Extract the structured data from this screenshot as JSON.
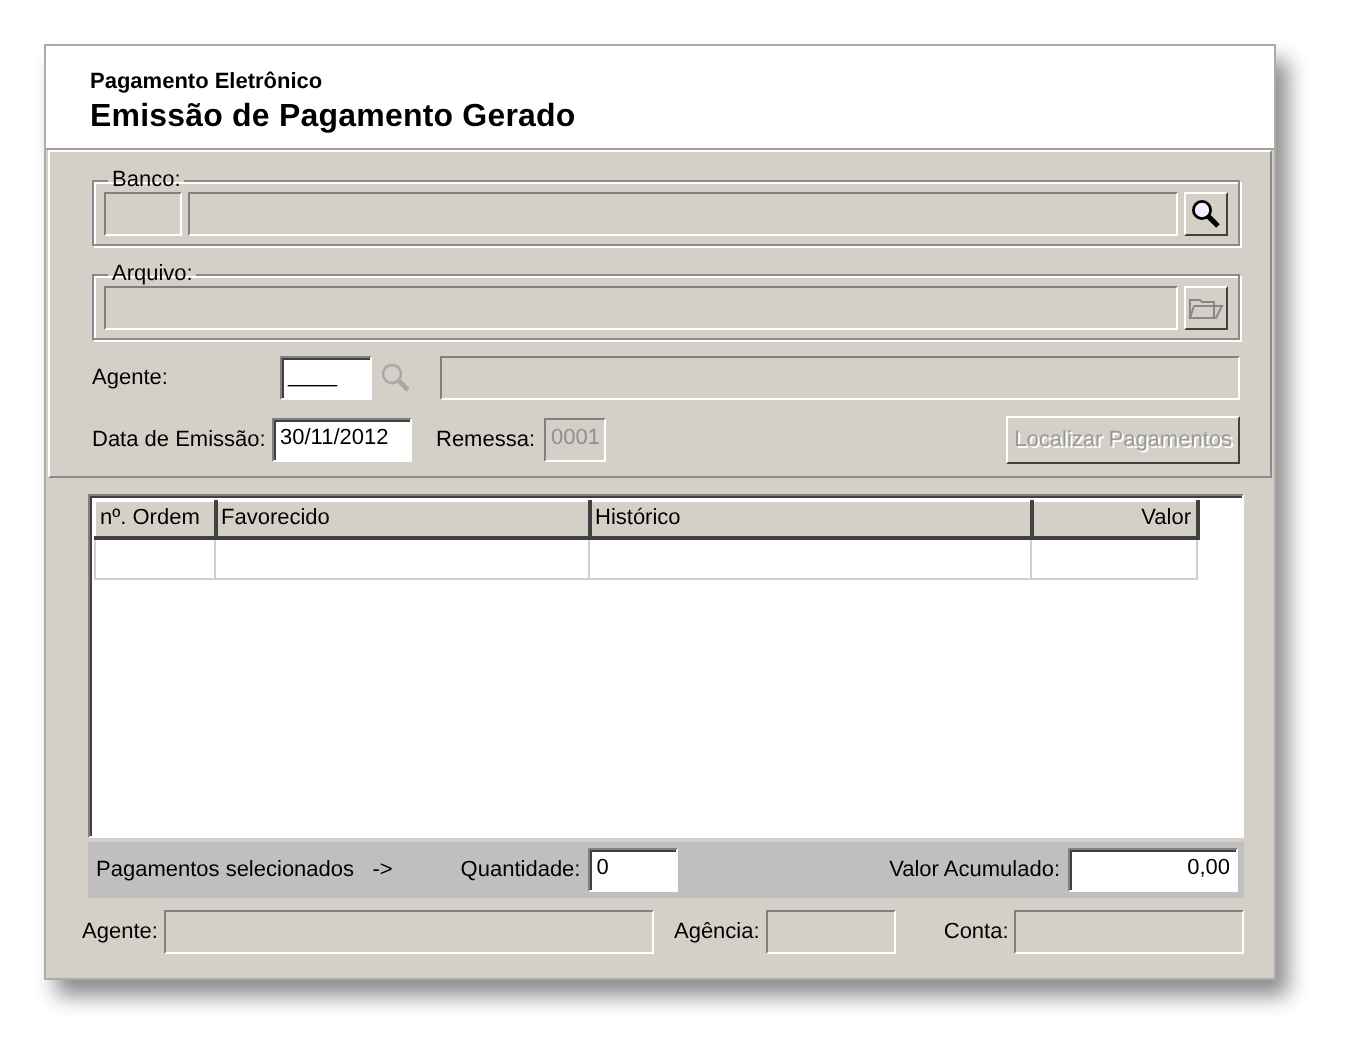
{
  "header": {
    "subtitle": "Pagamento Eletrônico",
    "title": "Emissão de Pagamento Gerado"
  },
  "banco": {
    "legend": "Banco:",
    "code": {
      "disabled": true
    },
    "name": {
      "disabled": true
    }
  },
  "arquivo": {
    "legend": "Arquivo:",
    "path": {
      "disabled": true
    }
  },
  "agente": {
    "label": "Agente:",
    "code": {
      "value": "____",
      "disabled": false
    },
    "search_disabled": true,
    "name": {
      "disabled": true
    }
  },
  "data_emissao": {
    "label": "Data de Emissão:",
    "value": "30/11/2012",
    "disabled": false
  },
  "remessa": {
    "label": "Remessa:",
    "value": "0001",
    "disabled": true
  },
  "localizar_button": {
    "label": "Localizar Pagamentos",
    "disabled": true
  },
  "table": {
    "columns": [
      {
        "label": "nº. Ordem",
        "kind": "text"
      },
      {
        "label": "Favorecido",
        "kind": "text"
      },
      {
        "label": "Histórico",
        "kind": "text"
      },
      {
        "label": "Valor",
        "kind": "number"
      }
    ],
    "rows": [
      {
        "kind": "blank"
      }
    ]
  },
  "summary": {
    "label": "Pagamentos selecionados   ->",
    "quantidade_label": "Quantidade:",
    "quantidade": "0",
    "valor_label": "Valor Acumulado:",
    "valor": "0,00"
  },
  "footer": [
    {
      "label": "Agente:"
    },
    {
      "label": "Agência:"
    },
    {
      "label": "Conta:"
    }
  ]
}
